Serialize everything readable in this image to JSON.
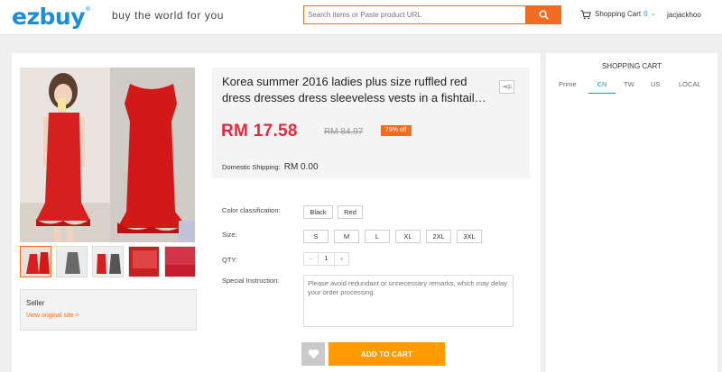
{
  "header": {
    "logo": "ezbuy",
    "logo_reg": "®",
    "tagline": "buy the world for you",
    "search_placeholder": "Search items or Paste product URL",
    "cart_label": "Shopping Cart",
    "cart_count": "0",
    "username": "jacjackhoo"
  },
  "product": {
    "title": "Korea summer 2016 ladies plus size ruffled red dress dresses dress sleeveless vests in a fishtail…",
    "lang_toggle": "中",
    "price": "RM 17.58",
    "original_price": "RM 84.97",
    "discount": "79% off",
    "shipping_label": "Domestic Shipping:",
    "shipping_value": "RM  0.00"
  },
  "options": {
    "color_label": "Color classification:",
    "colors": [
      "Black",
      "Red"
    ],
    "size_label": "Size:",
    "sizes": [
      "S",
      "M",
      "L",
      "XL",
      "2XL",
      "3XL"
    ],
    "qty_label": "QTY:",
    "qty_minus": "−",
    "qty_value": "1",
    "qty_plus": "+",
    "note_label": "Special Instruction:",
    "note_placeholder": "Please avoid redundant or unnecessary remarks, which may delay your order processing."
  },
  "seller": {
    "label": "Seller",
    "link": "View original site >"
  },
  "actions": {
    "add_to_cart": "ADD TO CART"
  },
  "cart_panel": {
    "title": "SHOPPING CART",
    "tabs": [
      "Prime",
      "CN",
      "TW",
      "US",
      "LOCAL"
    ],
    "active_tab": "CN"
  },
  "colors": {
    "brand_blue": "#1a8fd8",
    "accent_orange": "#f26d21",
    "price_red": "#e8273f",
    "cart_button": "#ff9a00"
  }
}
